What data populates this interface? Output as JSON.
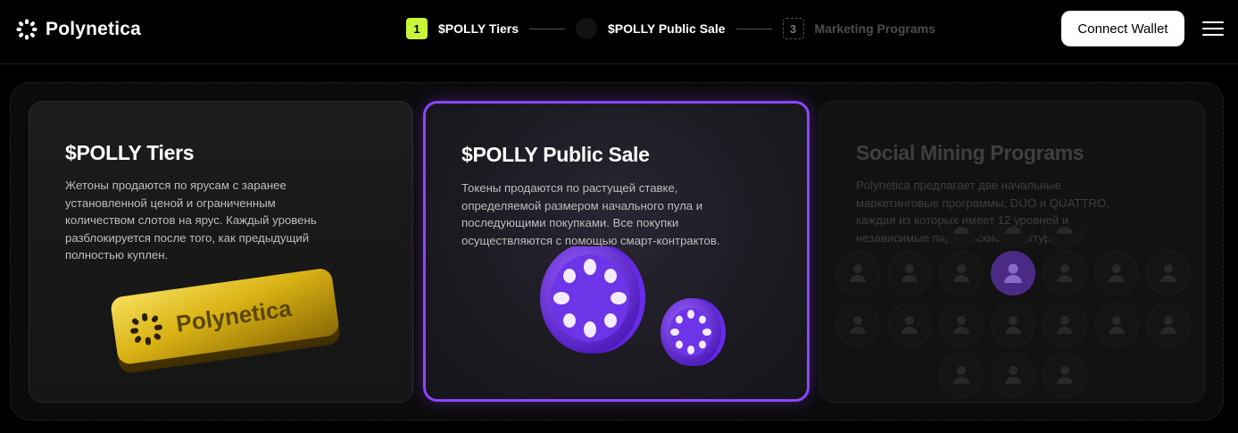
{
  "brand": {
    "name": "Polynetica"
  },
  "steps": [
    {
      "number": "1",
      "label": "$POLLY Tiers",
      "state": "active"
    },
    {
      "number": "",
      "label": "$POLLY Public Sale",
      "state": "done"
    },
    {
      "number": "3",
      "label": "Marketing Programs",
      "state": "todo"
    }
  ],
  "header": {
    "connect_label": "Connect Wallet"
  },
  "cards": [
    {
      "title": "$POLLY Tiers",
      "lines": [
        "Жетоны продаются по ярусам с заранее",
        "установленной ценой и ограниченным",
        "количеством слотов на ярус. Каждый уровень",
        "разблокируется после того, как предыдущий",
        "полностью куплен."
      ],
      "image_text": "Polynetica"
    },
    {
      "title": "$POLLY Public Sale",
      "lines": [
        "Токены продаются по растущей ставке,",
        "определяемой размером начального пула и",
        "последующими покупками. Все покупки",
        "осуществляются с помощью смарт-контрактов."
      ]
    },
    {
      "title": "Social Mining Programs",
      "lines": [
        "Polynetica предлагает две начальные",
        "маркетинговые программы, DUO и QUATTRO,",
        "каждая из которых имеет 12 уровней и",
        "независимые партнерские структуры."
      ]
    }
  ],
  "colors": {
    "accent_lime": "#c8f53a",
    "accent_purple": "#8b45ff",
    "background": "#000000"
  }
}
